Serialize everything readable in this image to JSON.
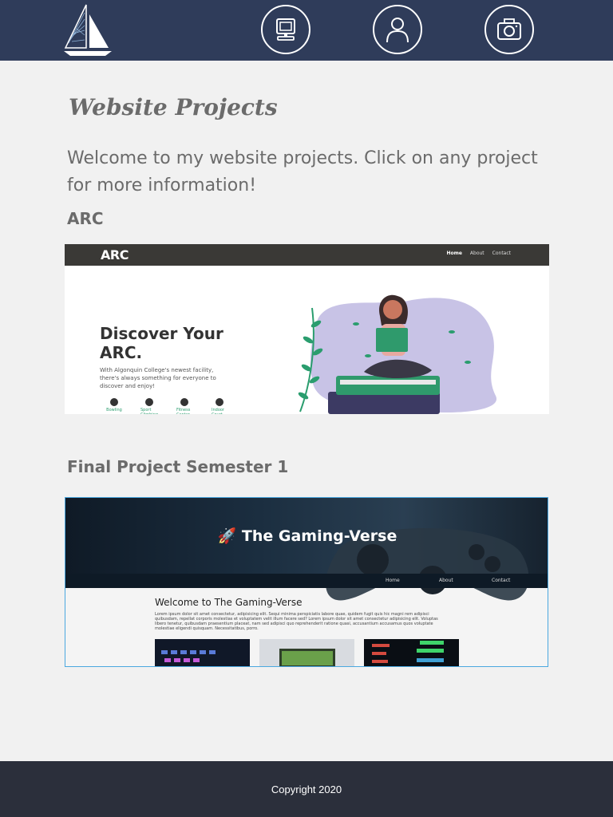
{
  "nav": {
    "icons": [
      "sailboat-logo",
      "computer-icon",
      "user-icon",
      "camera-icon"
    ]
  },
  "page": {
    "title": "Website Projects",
    "intro": "Welcome to my website projects. Click on any project for more information!"
  },
  "projects": [
    {
      "heading": "ARC",
      "preview": {
        "logo": "ARC",
        "links": [
          "Home",
          "About",
          "Contact"
        ],
        "headline": "Discover Your ARC.",
        "text": "With Algonquin College's newest facility, there's always something for everyone to discover and enjoy!",
        "features": [
          "Bowling",
          "Sport Climbing",
          "Fitness Center",
          "Indoor Court"
        ]
      }
    },
    {
      "heading": "Final Project Semester 1",
      "preview": {
        "title": "The Gaming-Verse",
        "links": [
          "Home",
          "About",
          "Contact"
        ],
        "headline": "Welcome to The Gaming-Verse",
        "text": "Lorem ipsum dolor sit amet consectetur, adipisicing elit. Sequi minima perspiciatis labore quae, quidem fugit quis hic magni rem adipisci quibusdam, repellat corporis molestias et voluptatem velit illum facere sed? Lorem ipsum dolor sit amet consectetur adipisicing elit. Voluptas libero tenetur, quibusdam praesentium placeat, nam sed adipisci quo reprehenderit ratione quasi, accusantium accusamus quos voluptate molestiae eligendi quisquam. Necessitatibus, porro."
      }
    }
  ],
  "footer": {
    "copyright": "Copyright 2020"
  },
  "colors": {
    "header": "#2f3c5a",
    "background": "#f1f1f1",
    "text": "#6b6b6b",
    "footer": "#2b2f3b",
    "accent_border": "#4aa8e0"
  }
}
